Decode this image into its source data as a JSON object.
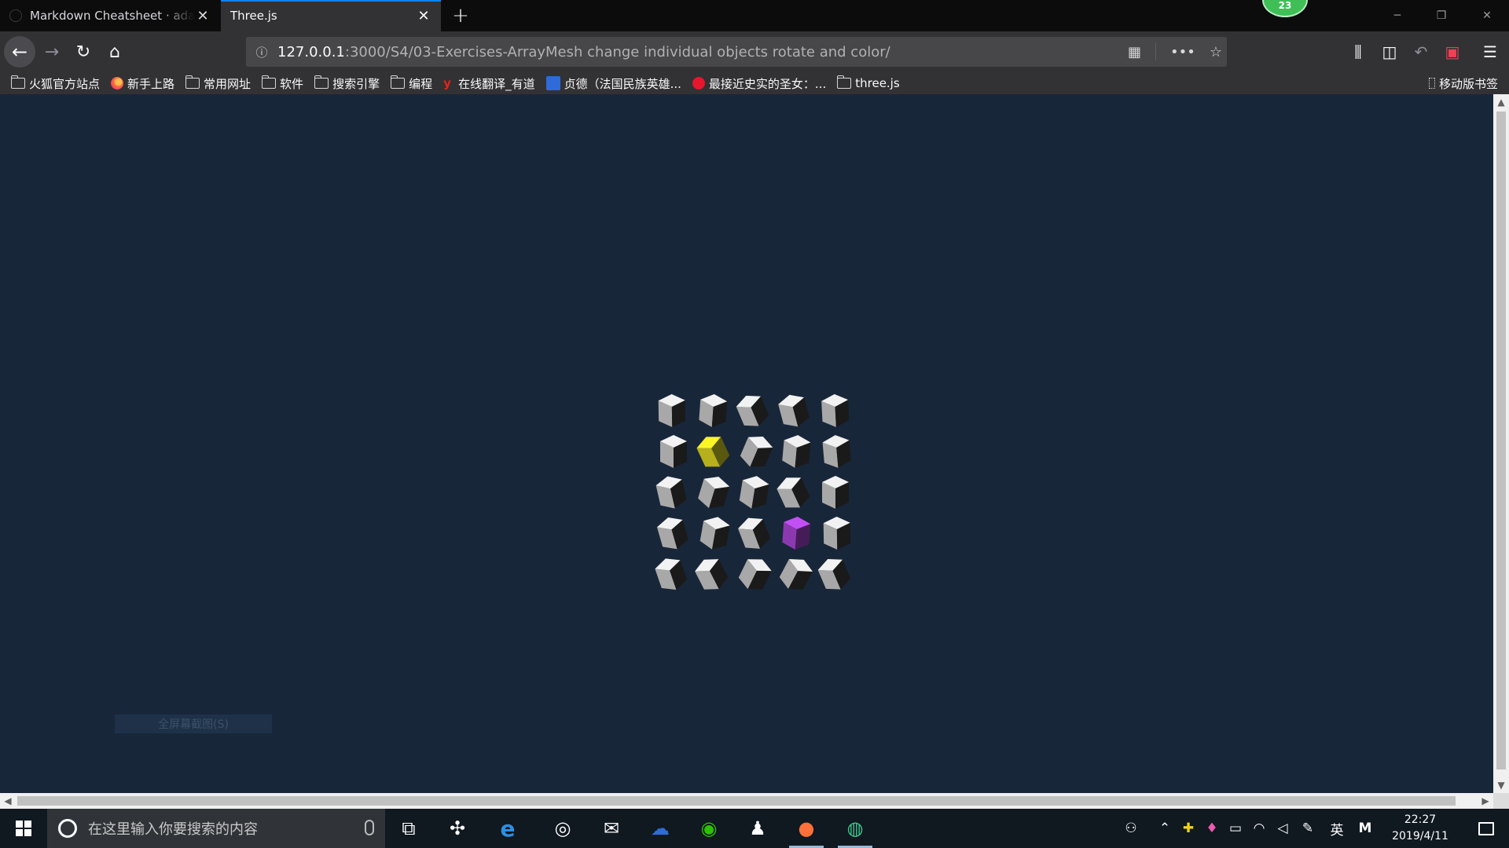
{
  "tabs": [
    {
      "title": "Markdown Cheatsheet · adam-p/markdown-here Wiki",
      "close": "✕"
    },
    {
      "title": "Three.js",
      "close": "✕"
    }
  ],
  "new_tab": "+",
  "profile_badge": "23",
  "window_controls": {
    "minimize": "─",
    "restore": "❐",
    "close": "✕"
  },
  "nav": {
    "back": "←",
    "forward": "→",
    "reload": "↻",
    "home": "⌂"
  },
  "url": {
    "host": "127.0.0.1",
    "rest": ":3000/S4/03-Exercises-ArrayMesh change individual objects rotate and color/",
    "info_icon": "ⓘ",
    "qr_icon": "▦",
    "more_icon": "•••",
    "star_icon": "☆"
  },
  "toolbar_icons": {
    "library": "⫼",
    "sidebar": "◫",
    "undo": "↶",
    "pocket": "▣",
    "menu": "☰"
  },
  "bookmarks": [
    {
      "label": "火狐官方站点",
      "icon": "folder"
    },
    {
      "label": "新手上路",
      "icon": "firefox"
    },
    {
      "label": "常用网址",
      "icon": "folder"
    },
    {
      "label": "软件",
      "icon": "folder"
    },
    {
      "label": "搜索引擎",
      "icon": "folder"
    },
    {
      "label": "编程",
      "icon": "folder"
    },
    {
      "label": "在线翻译_有道",
      "icon": "youdao"
    },
    {
      "label": "贞德（法国民族英雄...",
      "icon": "baidu"
    },
    {
      "label": "最接近史实的圣女：...",
      "icon": "weibo"
    },
    {
      "label": "three.js",
      "icon": "folder"
    }
  ],
  "bookmarks_mobile": "移动版书签",
  "screenshot_hint": "全屏幕截图(S)",
  "scene": {
    "background": "#18263a",
    "highlight_colors": {
      "yellow": "#c9c41e",
      "purple": "#9b3fc3"
    }
  },
  "taskbar": {
    "search_placeholder": "在这里输入你要搜索的内容",
    "ime": "英",
    "ime_mode": "M",
    "time": "22:27",
    "date": "2019/4/11"
  }
}
